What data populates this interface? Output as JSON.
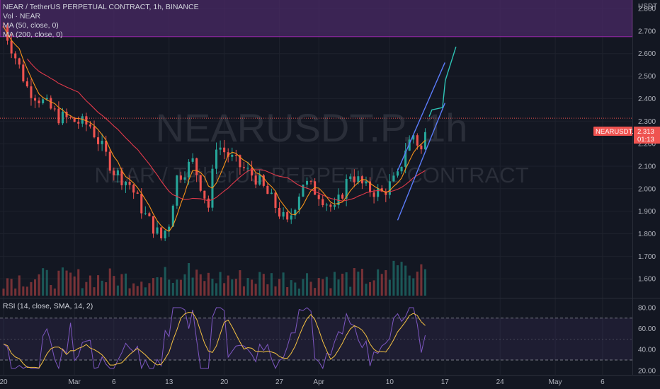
{
  "header": {
    "symbol_line": "NEAR / TetherUS PERPETUAL CONTRACT, 1h, BINANCE",
    "indicators": [
      "Vol · NEAR",
      "MA (50, close, 0)",
      "MA (200, close, 0)"
    ],
    "rsi_label": "RSI (14, close, SMA, 14, 2)"
  },
  "watermark": {
    "ticker": "NEARUSDT.P, 1h",
    "name": "NEAR / TetherUS PERPETUAL CONTRACT"
  },
  "price_axis": {
    "unit": "USDT",
    "ticks": [
      "2.800",
      "2.700",
      "2.600",
      "2.500",
      "2.400",
      "2.300",
      "2.200",
      "2.100",
      "2.000",
      "1.900",
      "1.800",
      "1.700",
      "1.600"
    ],
    "last_price_tag": "NEARUSDT.P",
    "last_price": "2.313",
    "countdown": "01:13"
  },
  "rsi_axis": {
    "ticks": [
      "80.00",
      "60.00",
      "40.00",
      "20.00"
    ]
  },
  "time_axis": {
    "labels": [
      "20",
      "Mar",
      "6",
      "13",
      "20",
      "27",
      "Apr",
      "10",
      "17",
      "24",
      "May",
      "6"
    ]
  },
  "colors": {
    "background": "#131722",
    "up": "#26a69a",
    "down": "#ef5350",
    "ma50": "#f7931a",
    "ma200": "#e0394a",
    "rsi": "#7e57c2",
    "rsi_ma": "#f5c242",
    "channel": "#5b7cfa",
    "projection": "#2ec4b6",
    "resistance_zone": "#4a2a66",
    "resistance_border": "#9c27b0"
  },
  "chart_data": {
    "type": "candlestick",
    "symbol": "NEARUSDT.P",
    "timeframe": "1h",
    "exchange": "BINANCE",
    "price_range": [
      1.56,
      2.88
    ],
    "resistance_zone": [
      2.675,
      2.88
    ],
    "last_price": 2.313,
    "trend_path": [
      {
        "date": "Feb 20",
        "price": 2.72
      },
      {
        "date": "Feb 23",
        "price": 2.45
      },
      {
        "date": "Feb 27",
        "price": 2.32
      },
      {
        "date": "Mar 3",
        "price": 2.28
      },
      {
        "date": "Mar 6",
        "price": 2.08
      },
      {
        "date": "Mar 8",
        "price": 2.02
      },
      {
        "date": "Mar 10",
        "price": 1.88
      },
      {
        "date": "Mar 12",
        "price": 1.78
      },
      {
        "date": "Mar 13",
        "price": 1.85
      },
      {
        "date": "Mar 14",
        "price": 2.05
      },
      {
        "date": "Mar 16",
        "price": 2.12
      },
      {
        "date": "Mar 18",
        "price": 1.92
      },
      {
        "date": "Mar 19",
        "price": 2.2
      },
      {
        "date": "Mar 21",
        "price": 2.13
      },
      {
        "date": "Mar 22",
        "price": 2.1
      },
      {
        "date": "Mar 24",
        "price": 2.05
      },
      {
        "date": "Mar 26",
        "price": 1.95
      },
      {
        "date": "Mar 28",
        "price": 1.84
      },
      {
        "date": "Mar 30",
        "price": 2.03
      },
      {
        "date": "Apr 1",
        "price": 1.98
      },
      {
        "date": "Apr 3",
        "price": 1.9
      },
      {
        "date": "Apr 5",
        "price": 2.07
      },
      {
        "date": "Apr 7",
        "price": 2.0
      },
      {
        "date": "Apr 9",
        "price": 1.98
      },
      {
        "date": "Apr 11",
        "price": 2.05
      },
      {
        "date": "Apr 12",
        "price": 2.18
      },
      {
        "date": "Apr 13",
        "price": 2.24
      },
      {
        "date": "Apr 14",
        "price": 2.17
      },
      {
        "date": "Apr 15",
        "price": 2.31
      }
    ],
    "channel": {
      "upper": [
        {
          "date": "Apr 11",
          "price": 2.08
        },
        {
          "date": "Apr 17",
          "price": 2.56
        }
      ],
      "lower": [
        {
          "date": "Apr 11",
          "price": 1.86
        },
        {
          "date": "Apr 17",
          "price": 2.38
        }
      ]
    },
    "projection": [
      {
        "date": "Apr 15",
        "price": 2.32
      },
      {
        "date": "Apr 15",
        "price": 2.35
      },
      {
        "date": "Apr 16",
        "price": 2.36
      },
      {
        "date": "Apr 16",
        "price": 2.48
      },
      {
        "date": "Apr 17",
        "price": 2.63
      }
    ],
    "rsi": {
      "range": [
        16,
        84
      ],
      "upper_band": 70,
      "lower_band": 30,
      "mid": 50
    }
  }
}
